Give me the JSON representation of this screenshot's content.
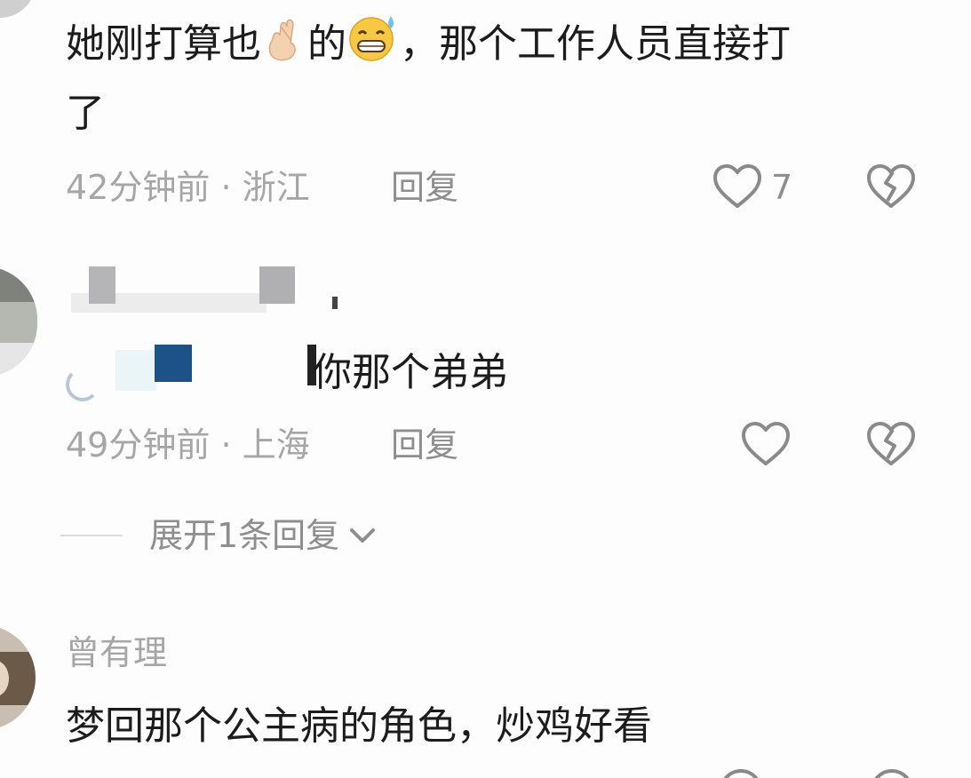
{
  "comments": [
    {
      "text_part1": "她刚打算也",
      "emoji1": "crossed-fingers-emoji",
      "text_part2": "的",
      "emoji2": "grinning-sweat-emoji",
      "text_part3": "，那个工作人员直接打",
      "text_line2": "了",
      "time": "42分钟前",
      "location": "· 浙江",
      "reply_label": "回复",
      "like_count": "7"
    },
    {
      "text": "你那个弟弟",
      "time": "49分钟前",
      "location": "· 上海",
      "reply_label": "回复",
      "expand_label": "展开1条回复"
    },
    {
      "username": "曾有理",
      "text": "梦回那个公主病的角色，炒鸡好看"
    }
  ],
  "icons": {
    "like": "heart-outline-icon",
    "dislike": "broken-heart-icon",
    "expand": "chevron-down-icon"
  },
  "colors": {
    "background": "#fdfdfd",
    "text": "#1c1c1c",
    "meta": "#a6a6a6",
    "icon": "#8a8a8a",
    "redaction_blue": "#1d5289"
  }
}
